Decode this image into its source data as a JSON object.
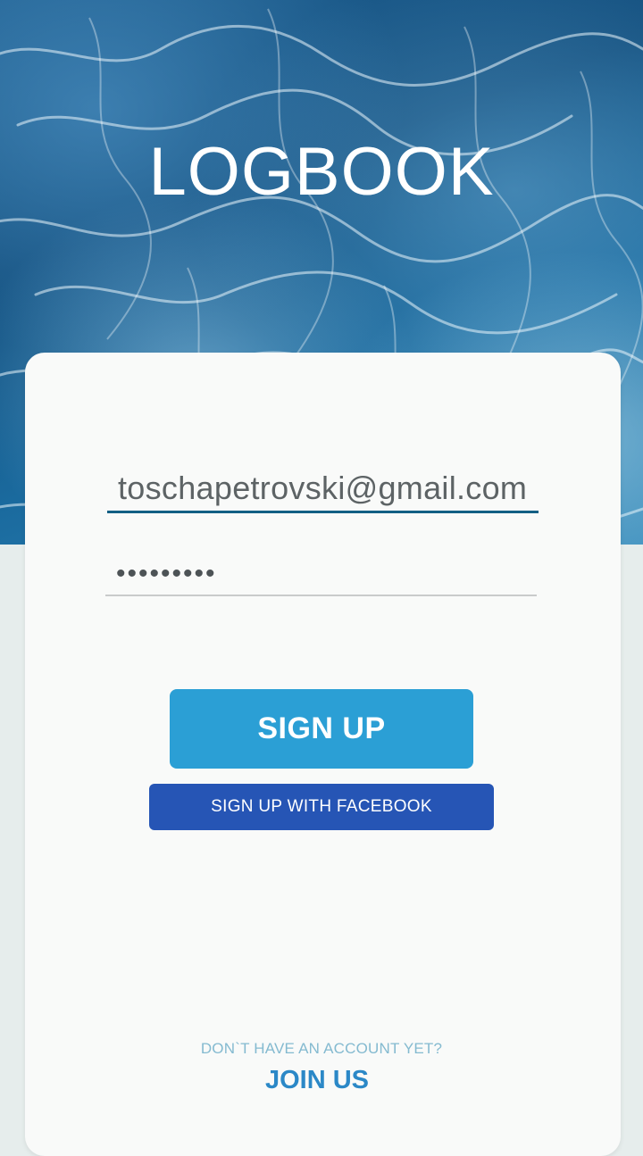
{
  "app": {
    "title": "LOGBOOK"
  },
  "form": {
    "email_value": "toschapetrovski@gmail.com",
    "password_value": "123456789"
  },
  "buttons": {
    "sign_up_label": "SIGN UP",
    "facebook_label": "SIGN UP WITH FACEBOOK"
  },
  "footer": {
    "no_account_text": "DON`T HAVE AN ACCOUNT YET?",
    "join_label": "JOIN US"
  },
  "colors": {
    "accent": "#2b9fd5",
    "facebook": "#2655b5",
    "input_underline_active": "#135f84",
    "join_link": "#2b88c7"
  },
  "icons": {
    "background": "ocean-water-image"
  }
}
